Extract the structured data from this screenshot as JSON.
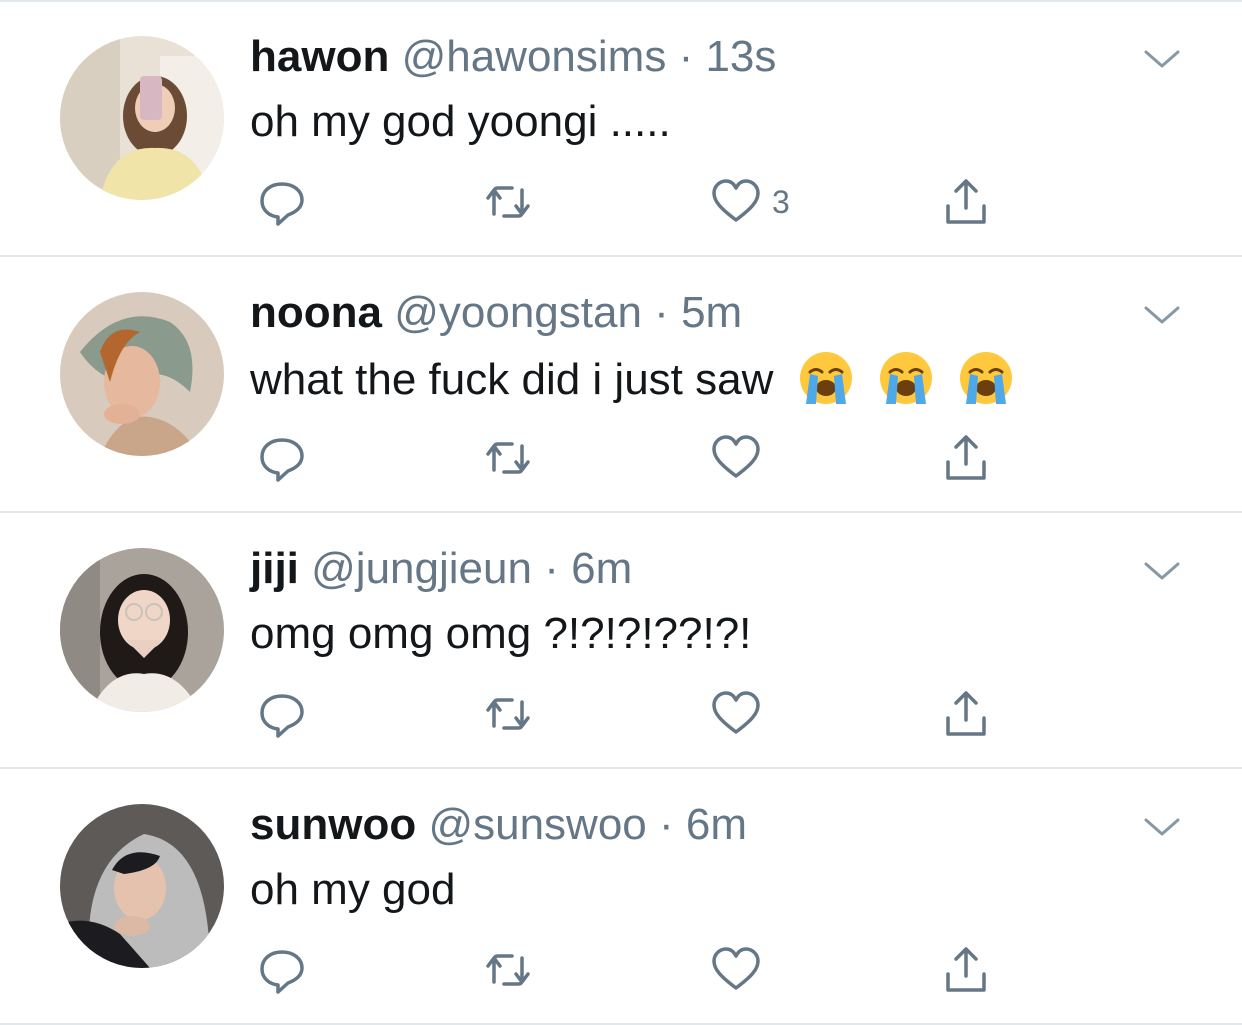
{
  "tweets": [
    {
      "name": "hawon",
      "handle": "@hawonsims",
      "separator": "·",
      "time": "13s",
      "text": "oh my god yoongi .....",
      "emojis": [],
      "likes": "3",
      "avatar_colors": [
        "#e9e1d6",
        "#f0e4a8",
        "#6b4a36"
      ]
    },
    {
      "name": "noona",
      "handle": "@yoongstan",
      "separator": "·",
      "time": "5m",
      "text": "what the fuck did i just saw",
      "emojis": [
        "loudly-crying-face",
        "loudly-crying-face",
        "loudly-crying-face"
      ],
      "likes": "",
      "avatar_colors": [
        "#d8cbbd",
        "#8a9a8c",
        "#b3672f"
      ]
    },
    {
      "name": "jiji",
      "handle": "@jungjieun",
      "separator": "·",
      "time": "6m",
      "text": "omg omg omg ?!?!?!??!?!",
      "emojis": [],
      "likes": "",
      "avatar_colors": [
        "#a9a39c",
        "#f2ece6",
        "#1f1a18"
      ]
    },
    {
      "name": "sunwoo",
      "handle": "@sunswoo",
      "separator": "·",
      "time": "6m",
      "text": "oh my god",
      "emojis": [],
      "likes": "",
      "avatar_colors": [
        "#5d5a58",
        "#bcbcbc",
        "#1c1c20"
      ]
    }
  ],
  "icons": {
    "reply": "reply-icon",
    "retweet": "retweet-icon",
    "like": "heart-icon",
    "share": "share-icon",
    "menu": "chevron-down-icon"
  },
  "colors": {
    "icon_gray": "#657786",
    "divider": "#e1e8ed",
    "text": "#14171a"
  }
}
